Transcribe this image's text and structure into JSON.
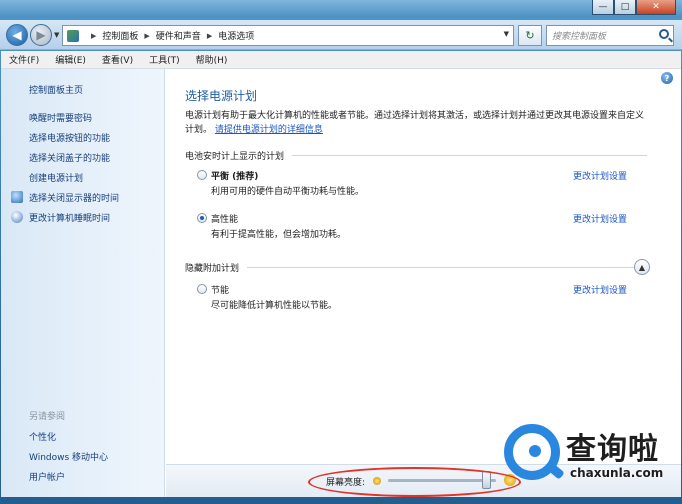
{
  "window": {
    "minimize": "—",
    "maximize": "□",
    "close": "✕"
  },
  "address": {
    "breadcrumbs": [
      "控制面板",
      "硬件和声音",
      "电源选项"
    ],
    "search_placeholder": "搜索控制面板"
  },
  "menu": [
    "文件(F)",
    "编辑(E)",
    "查看(V)",
    "工具(T)",
    "帮助(H)"
  ],
  "sidebar": {
    "home": "控制面板主页",
    "links": [
      "唤醒时需要密码",
      "选择电源按钮的功能",
      "选择关闭盖子的功能",
      "创建电源计划",
      "选择关闭显示器的时间",
      "更改计算机睡眠时间"
    ],
    "see_also_title": "另请参阅",
    "see_also": [
      "个性化",
      "Windows 移动中心",
      "用户帐户"
    ]
  },
  "main": {
    "title": "选择电源计划",
    "description": "电源计划有助于最大化计算机的性能或者节能。通过选择计划将其激活，或选择计划并通过更改其电源设置来自定义计划。",
    "description_link": "请提供电源计划的详细信息",
    "group_shown": "电池安时计上显示的计划",
    "group_hidden": "隐藏附加计划",
    "change_link": "更改计划设置",
    "plans": [
      {
        "name": "平衡 (推荐)",
        "desc": "利用可用的硬件自动平衡功耗与性能。",
        "selected": false
      },
      {
        "name": "高性能",
        "desc": "有利于提高性能，但会增加功耗。",
        "selected": true
      },
      {
        "name": "节能",
        "desc": "尽可能降低计算机性能以节能。",
        "selected": false
      }
    ]
  },
  "brightness": {
    "label": "屏幕亮度:",
    "level": 0.92
  },
  "watermark": {
    "cn": "查询啦",
    "en": "chaxunla.com"
  },
  "colors": {
    "link": "#1a55c4",
    "title": "#1e5fa0",
    "highlight_ring": "#e33226"
  }
}
